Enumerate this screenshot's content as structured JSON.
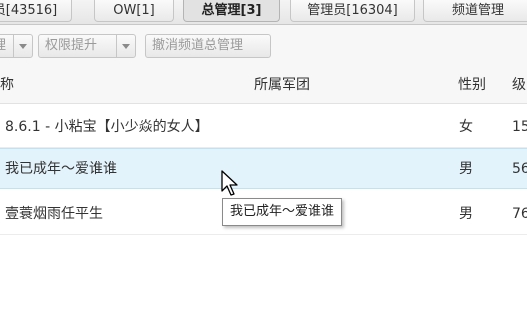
{
  "tabs": [
    {
      "label": "员[43516]"
    },
    {
      "label": "OW[1]"
    },
    {
      "label": "总管理[3]"
    },
    {
      "label": "管理员[16304]"
    },
    {
      "label": "频道管理"
    }
  ],
  "toolbar": {
    "first_button_label": "理",
    "promote_button_label": "权限提升",
    "revoke_button_label": "撤消频道总管理"
  },
  "table": {
    "columns": {
      "name": "称",
      "legion": "所属军团",
      "gender": "性别",
      "level": "级"
    },
    "rows": [
      {
        "name": "8.6.1 - 小粘宝【小少焱的女人】",
        "legion": "",
        "gender": "女",
        "level": "15"
      },
      {
        "name": "我已成年～爱谁谁",
        "legion": "",
        "gender": "男",
        "level": "56"
      },
      {
        "name": "壹蓑烟雨任平生",
        "legion": "",
        "gender": "男",
        "level": "76"
      }
    ]
  },
  "tooltip": {
    "text": "我已成年～爱谁谁"
  },
  "colors": {
    "selected_row": "#e3f3fb",
    "disabled_text": "#9a9a9a"
  }
}
